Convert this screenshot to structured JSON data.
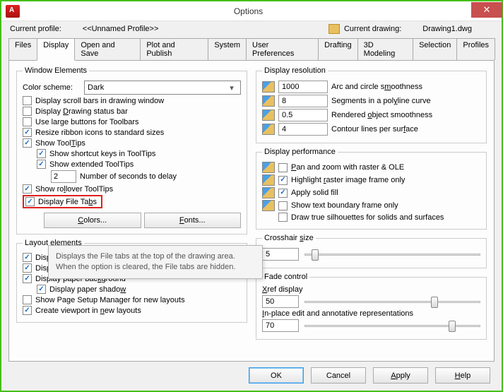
{
  "title": "Options",
  "header": {
    "profile_label": "Current profile:",
    "profile_value": "<<Unnamed Profile>>",
    "drawing_label": "Current drawing:",
    "drawing_value": "Drawing1.dwg"
  },
  "tabs": [
    "Files",
    "Display",
    "Open and Save",
    "Plot and Publish",
    "System",
    "User Preferences",
    "Drafting",
    "3D Modeling",
    "Selection",
    "Profiles"
  ],
  "active_tab": "Display",
  "window_elements": {
    "legend": "Window Elements",
    "color_scheme_label": "Color scheme:",
    "color_scheme_value": "Dark",
    "scroll_bars": "Display scroll bars in drawing window",
    "status_bar": "Display Drawing status bar",
    "large_buttons": "Use large buttons for Toolbars",
    "resize_icons": "Resize ribbon icons to standard sizes",
    "show_tooltips": "Show ToolTips",
    "shortcut_keys": "Show shortcut keys in ToolTips",
    "extended_tooltips": "Show extended ToolTips",
    "seconds_value": "2",
    "seconds_label": "Number of seconds to delay",
    "rollover": "Show rollover ToolTips",
    "file_tabs": "Display File Tabs",
    "colors_btn": "Colors...",
    "fonts_btn": "Fonts..."
  },
  "layout_elements": {
    "legend": "Layout elements",
    "layout_model": "Display Layout and Model tabs",
    "printable": "Display printable area",
    "paper_bg": "Display paper background",
    "paper_shadow": "Display paper shadow",
    "page_setup": "Show Page Setup Manager for new layouts",
    "viewport": "Create viewport in new layouts"
  },
  "display_resolution": {
    "legend": "Display resolution",
    "arc_value": "1000",
    "arc_label": "Arc and circle smoothness",
    "seg_value": "8",
    "seg_label": "Segments in a polyline curve",
    "rend_value": "0.5",
    "rend_label": "Rendered object smoothness",
    "cont_value": "4",
    "cont_label": "Contour lines per surface"
  },
  "display_performance": {
    "legend": "Display performance",
    "pan_zoom": "Pan and zoom with raster & OLE",
    "highlight": "Highlight raster image frame only",
    "solid_fill": "Apply solid fill",
    "text_boundary": "Show text boundary frame only",
    "true_sil": "Draw true silhouettes for solids and surfaces"
  },
  "crosshair": {
    "legend": "Crosshair size",
    "value": "5"
  },
  "fade": {
    "legend": "Fade control",
    "xref_label": "Xref display",
    "xref_value": "50",
    "inplace_label": "In-place edit and annotative representations",
    "inplace_value": "70"
  },
  "tooltip_text": "Displays the File tabs at the top of the drawing area. When the option is cleared, the File tabs are hidden.",
  "footer": {
    "ok": "OK",
    "cancel": "Cancel",
    "apply": "Apply",
    "help": "Help"
  }
}
